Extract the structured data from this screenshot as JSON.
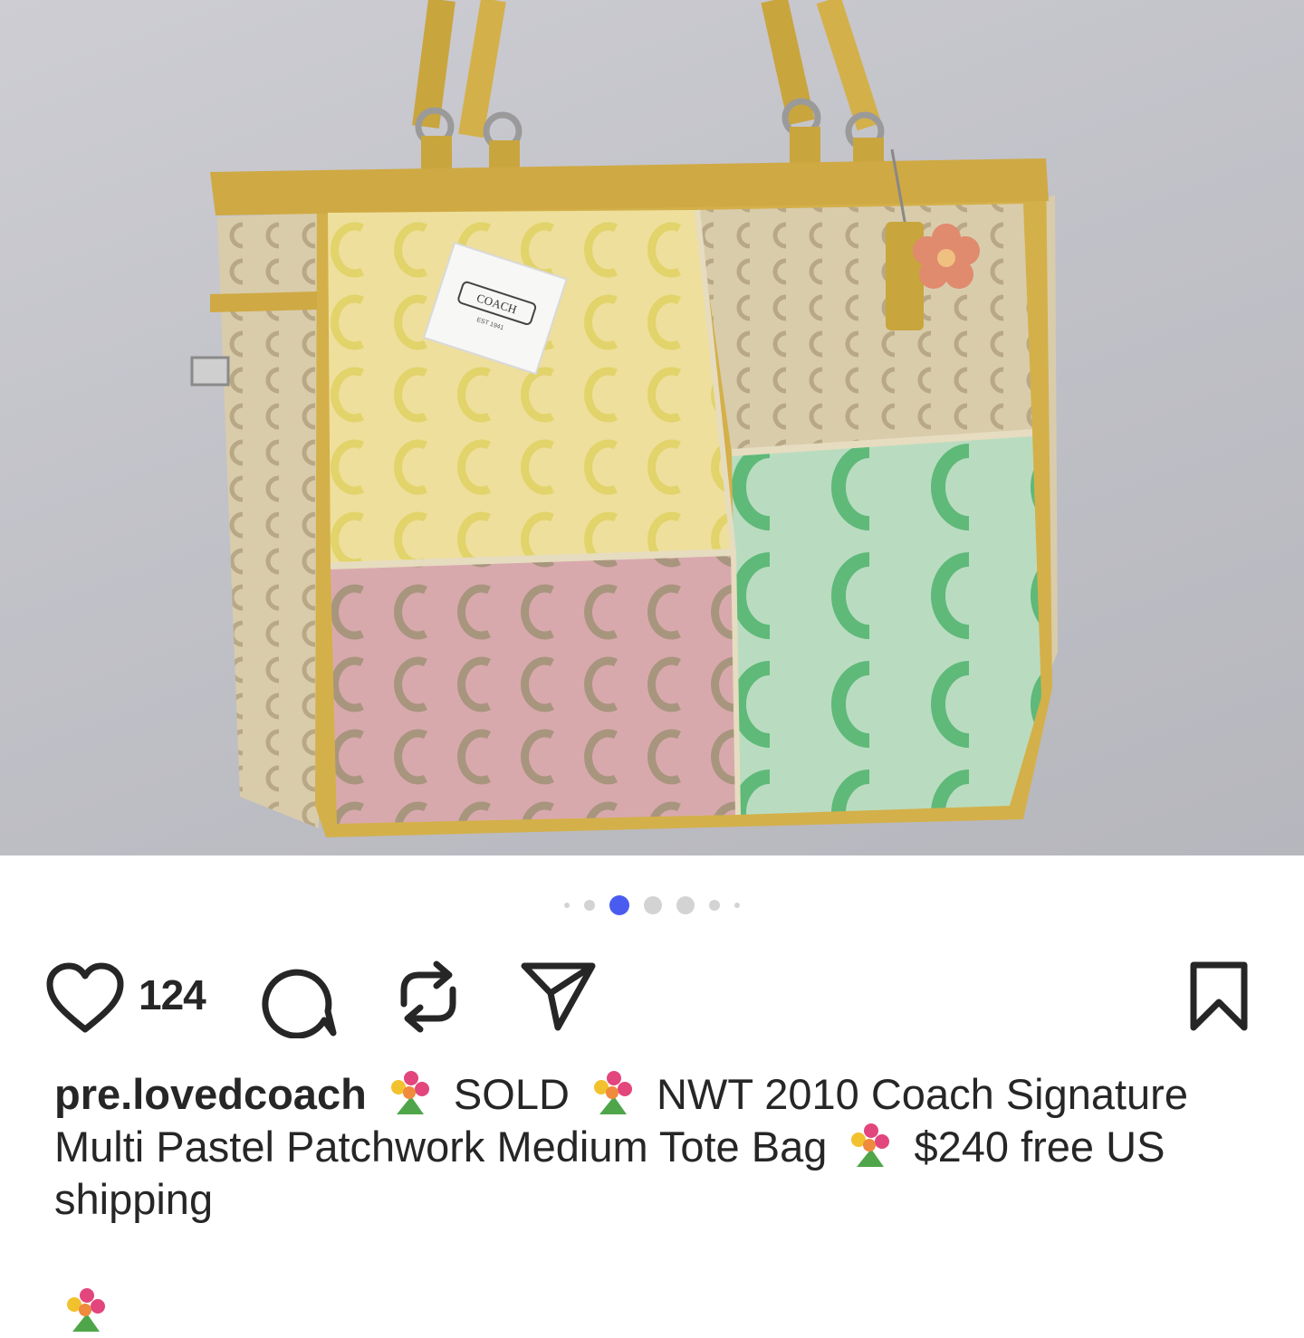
{
  "post": {
    "image_alt": "Coach patchwork tote bag photo",
    "tag_brand": "COACH",
    "tag_est": "EST 1941",
    "carousel": {
      "total": 7,
      "active_index": 2
    },
    "likes": "124",
    "icons": {
      "like": "heart-icon",
      "comment": "comment-icon",
      "repost": "repost-icon",
      "share": "send-icon",
      "save": "bookmark-icon"
    },
    "caption": {
      "username": "pre.lovedcoach",
      "emoji": "bouquet-emoji",
      "seg1": " SOLD ",
      "seg2": " NWT 2010 Coach Signature Multi Pastel Patchwork Medium Tote Bag ",
      "seg3": " $240 free US shipping"
    }
  },
  "colors": {
    "text": "#262626",
    "active_dot": "#4a5cf0",
    "inactive_dot": "#d3d3d3"
  }
}
